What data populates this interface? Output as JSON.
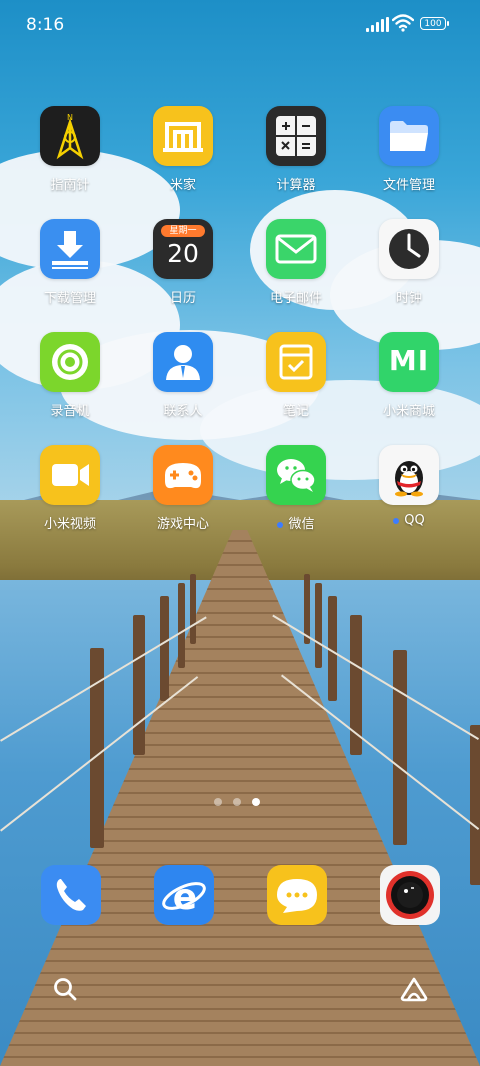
{
  "status_bar": {
    "time": "8:16",
    "battery": "100"
  },
  "apps": [
    {
      "label": "指南针",
      "icon": "compass-icon"
    },
    {
      "label": "米家",
      "icon": "mi-home-icon"
    },
    {
      "label": "计算器",
      "icon": "calculator-icon"
    },
    {
      "label": "文件管理",
      "icon": "folder-icon"
    },
    {
      "label": "下载管理",
      "icon": "download-icon"
    },
    {
      "label": "日历",
      "icon": "calendar-icon",
      "weekday": "星期一",
      "day": "20"
    },
    {
      "label": "电子邮件",
      "icon": "mail-icon"
    },
    {
      "label": "时钟",
      "icon": "clock-icon"
    },
    {
      "label": "录音机",
      "icon": "recorder-icon"
    },
    {
      "label": "联系人",
      "icon": "contacts-icon"
    },
    {
      "label": "笔记",
      "icon": "notes-icon"
    },
    {
      "label": "小米商城",
      "icon": "mi-store-icon",
      "logo": "MI"
    },
    {
      "label": "小米视频",
      "icon": "video-icon"
    },
    {
      "label": "游戏中心",
      "icon": "game-center-icon"
    },
    {
      "label": "微信",
      "icon": "wechat-icon"
    },
    {
      "label": "QQ",
      "icon": "qq-icon"
    }
  ],
  "dock": [
    {
      "name": "phone",
      "icon": "phone-icon"
    },
    {
      "name": "browser",
      "icon": "browser-icon"
    },
    {
      "name": "messages",
      "icon": "messages-icon"
    },
    {
      "name": "camera",
      "icon": "camera-icon"
    }
  ],
  "page_indicator": {
    "pages": 3,
    "current": 3
  },
  "colors": {
    "notification_dot": "#3d7dff"
  }
}
